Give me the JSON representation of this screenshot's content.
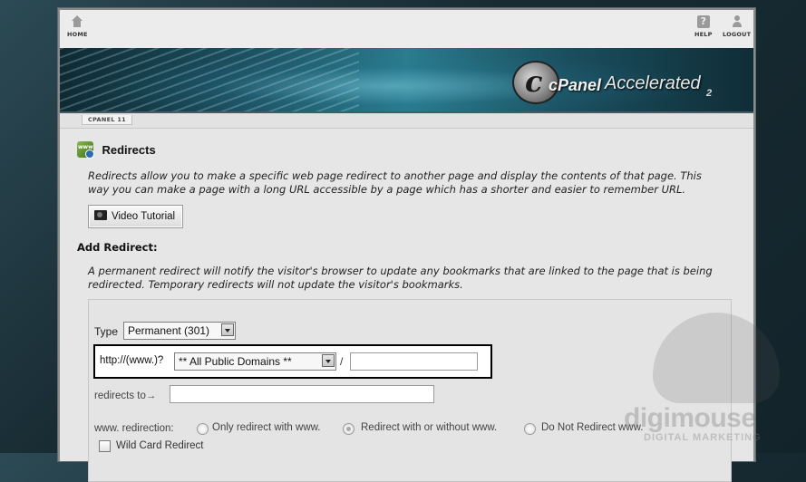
{
  "topnav": {
    "home_label": "HOME",
    "help_label": "HELP",
    "logout_label": "LOGOUT"
  },
  "banner": {
    "logo_letter": "c",
    "brand_name": "cPanel",
    "brand_suffix": "Accelerated",
    "brand_version": "2"
  },
  "breadcrumb": {
    "label": "CPANEL 11"
  },
  "page": {
    "title": "Redirects",
    "description": "Redirects allow you to make a specific web page redirect to another page and display the contents of that page. This way you can make a page with a long URL accessible by a page which has a shorter and easier to remember URL.",
    "video_button": "Video Tutorial",
    "add_title": "Add Redirect:",
    "add_description": "A permanent redirect will notify the visitor's browser to update any bookmarks that are linked to the page that is being redirected. Temporary redirects will not update the visitor's bookmarks."
  },
  "form": {
    "type_label": "Type",
    "type_value": "Permanent (301)",
    "protocol_label": "http://(www.)?",
    "domain_value": "** All Public Domains **",
    "path_separator": "/",
    "path_value": "",
    "redirects_to_label": "redirects to→",
    "redirects_to_value": "",
    "www_label": "www. redirection:",
    "www_options": [
      {
        "label": "Only redirect with www.",
        "selected": false
      },
      {
        "label": "Redirect with or without www.",
        "selected": true
      },
      {
        "label": "Do Not Redirect www.",
        "selected": false
      }
    ],
    "wildcard_label": "Wild Card Redirect",
    "wildcard_checked": false
  },
  "watermark": {
    "text": "digimouse",
    "subtext": "DIGITAL MARKETING"
  }
}
